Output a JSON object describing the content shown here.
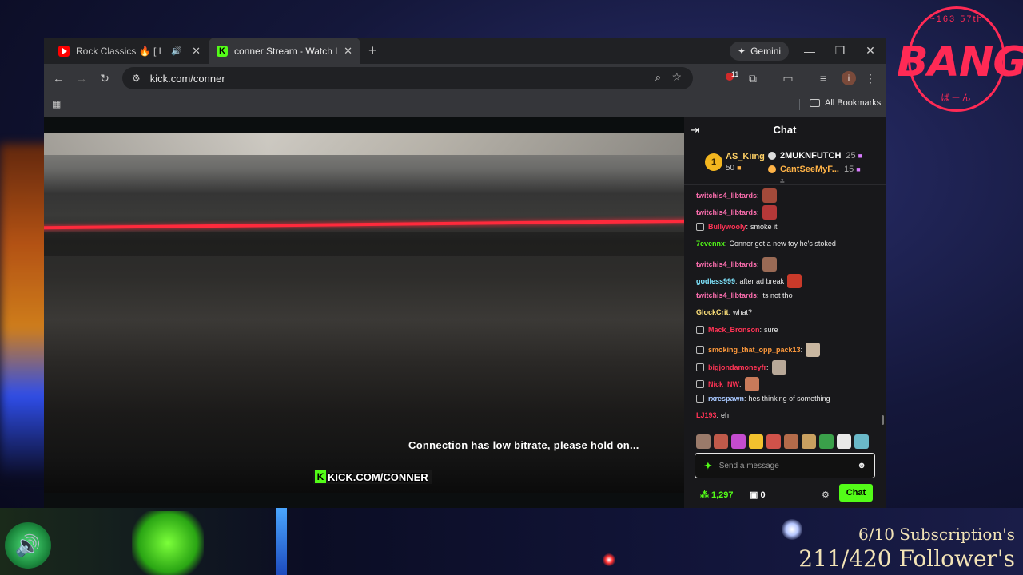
{
  "browser": {
    "tabs": [
      {
        "title": "Rock Classics 🔥 [ LIVE ] Ti",
        "favicon": "youtube-icon",
        "audio": "speaker-icon"
      },
      {
        "title": "conner Stream - Watch Live on",
        "favicon": "kick-icon"
      }
    ],
    "gemini_label": "Gemini",
    "url": "kick.com/conner",
    "extension_badge": "11",
    "avatar_letter": "i",
    "all_bookmarks": "All Bookmarks"
  },
  "video": {
    "status_text": "Connection has low bitrate, please hold on...",
    "watermark": "KICK.COM/CONNER"
  },
  "chat": {
    "title": "Chat",
    "leaderboard": {
      "first": {
        "rank": "1",
        "name": "AS_Kiing",
        "count": "50"
      },
      "second": {
        "name": "2MUKNFUTCH",
        "count": "25"
      },
      "third": {
        "name": "CantSeeMyF...",
        "count": "15"
      }
    },
    "messages": [
      {
        "user": "twitchis4_libtards",
        "text": "",
        "color": "#ff6fb0",
        "emote": "#a34a3a"
      },
      {
        "user": "twitchis4_libtards",
        "text": "",
        "color": "#ff6fb0",
        "emote": "#b53838"
      },
      {
        "user": "Bullywooly",
        "text": "smoke it",
        "color": "#ff3355",
        "badge": true
      },
      {
        "user": "7evennx",
        "text": "Conner got a new toy he's stoked",
        "color": "#53fc18"
      },
      {
        "user": "twitchis4_libtards",
        "text": "",
        "color": "#ff6fb0",
        "emote": "#9a6a55"
      },
      {
        "user": "godless999",
        "text": "after ad break",
        "color": "#7fe6ff",
        "emote": "#c93a2a"
      },
      {
        "user": "twitchis4_libtards",
        "text": "its not tho",
        "color": "#ff6fb0"
      },
      {
        "user": "GlockCrit",
        "text": "what?",
        "color": "#ffe27a"
      },
      {
        "user": "Mack_Bronson",
        "text": "sure",
        "color": "#ff3355",
        "badge": true
      },
      {
        "user": "smoking_that_opp_pack13",
        "text": "",
        "color": "#ff9a3c",
        "badge": true,
        "emote": "#c8b6a0"
      },
      {
        "user": "bigjondamoneyfr",
        "text": "",
        "color": "#ff3355",
        "badge": true,
        "emote": "#b8a898"
      },
      {
        "user": "Nick_NW",
        "text": "",
        "color": "#ff3355",
        "badge": true,
        "emote": "#c87a5a"
      },
      {
        "user": "rxrespawn",
        "text": "hes thinking of something",
        "color": "#a8c8ff",
        "badge": true
      },
      {
        "user": "LJ193",
        "text": "eh",
        "color": "#ff3355"
      }
    ],
    "emote_bar": [
      "#9a7a6a",
      "#c05a4a",
      "#c44ccf",
      "#f2c12e",
      "#d0524a",
      "#b46b4a",
      "#c9a060",
      "#3aa04a",
      "#e8e8e8",
      "#6ab8c8"
    ],
    "composer_placeholder": "Send a message",
    "points": "1,297",
    "gifts": "0",
    "send_label": "Chat"
  },
  "overlay": {
    "logo_text": "BANG",
    "logo_top": "~163 57th",
    "logo_bottom": "ばーん",
    "subs": "6/10 Subscription's",
    "followers": "211/420 Follower's"
  },
  "colors": {
    "kick_green": "#53fc18",
    "accent_red": "#ff2a3c"
  }
}
